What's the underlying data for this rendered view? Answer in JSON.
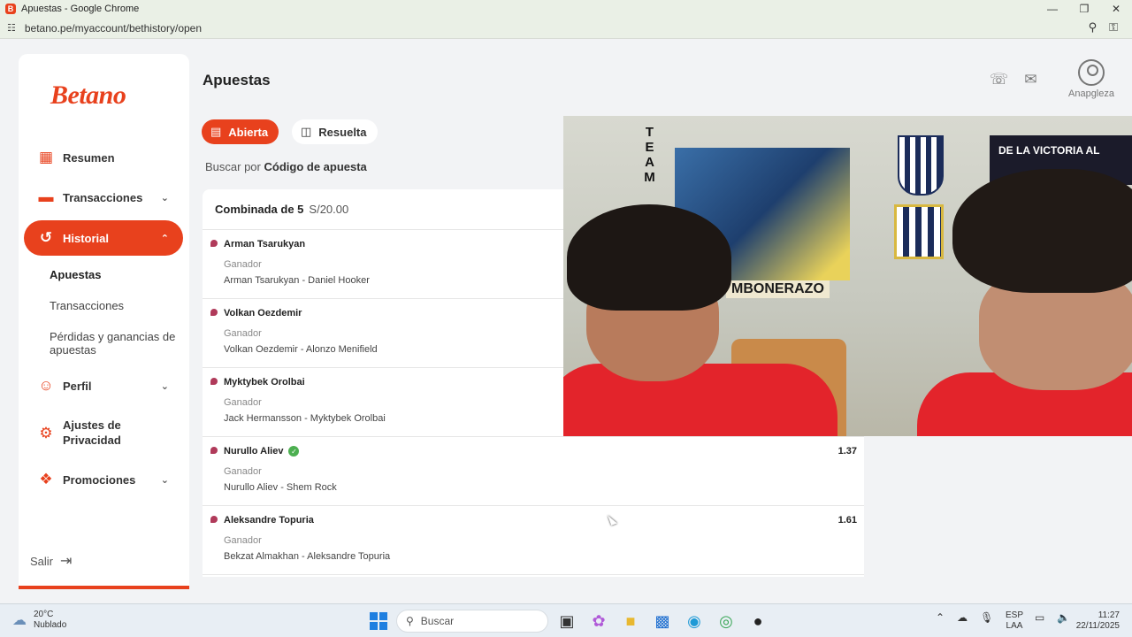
{
  "window": {
    "title": "Apuestas - Google Chrome",
    "url": "betano.pe/myaccount/bethistory/open"
  },
  "sidebar": {
    "brand": "Betano",
    "items": [
      {
        "label": "Resumen",
        "icon": "grid-icon"
      },
      {
        "label": "Transacciones",
        "icon": "card-icon"
      },
      {
        "label": "Historial",
        "icon": "history-icon"
      },
      {
        "label": "Perfil",
        "icon": "user-icon"
      },
      {
        "label": "Ajustes de Privacidad",
        "icon": "gear-icon"
      },
      {
        "label": "Promociones",
        "icon": "gift-icon"
      }
    ],
    "sub_items": [
      "Apuestas",
      "Transacciones",
      "Pérdidas y ganancias de apuestas"
    ],
    "logout": "Salir"
  },
  "header": {
    "title": "Apuestas",
    "username": "Anapgleza"
  },
  "tabs": {
    "open": "Abierta",
    "resolved": "Resuelta"
  },
  "search": {
    "prefix": "Buscar por",
    "field": "Código de apuesta"
  },
  "bet": {
    "title": "Combinada de 5",
    "stake": "S/20.00",
    "selections": [
      {
        "pick": "Arman Tsarukyan",
        "market": "Ganador",
        "event": "Arman Tsarukyan - Daniel Hooker",
        "odds": "",
        "won": false
      },
      {
        "pick": "Volkan Oezdemir",
        "market": "Ganador",
        "event": "Volkan Oezdemir - Alonzo Menifield",
        "odds": "",
        "won": false
      },
      {
        "pick": "Myktybek Orolbai",
        "market": "Ganador",
        "event": "Jack Hermansson - Myktybek Orolbai",
        "odds": "",
        "won": false
      },
      {
        "pick": "Nurullo Aliev",
        "market": "Ganador",
        "event": "Nurullo Aliev - Shem Rock",
        "odds": "1.37",
        "won": true
      },
      {
        "pick": "Aleksandre Topuria",
        "market": "Ganador",
        "event": "Bekzat Almakhan - Aleksandre Topuria",
        "odds": "1.61",
        "won": false
      }
    ]
  },
  "webcam": {
    "strip_text": "TEAM",
    "banner_text": "MBONERAZO",
    "flag_text": "DE LA VICTORIA AL"
  },
  "taskbar": {
    "temp": "20°C",
    "weather": "Nublado",
    "search": "Buscar",
    "lang1": "ESP",
    "lang2": "LAA",
    "time": "11:27",
    "date": "22/11/2025"
  },
  "colors": {
    "brand": "#e8411d",
    "success": "#4caf50"
  }
}
